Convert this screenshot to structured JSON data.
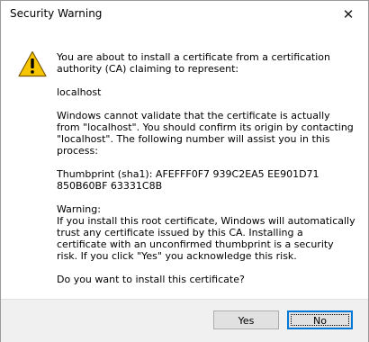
{
  "window": {
    "title": "Security Warning",
    "close_label": "✕"
  },
  "icon": "warning-triangle-icon",
  "message": {
    "intro": "You are about to install a certificate from a certification authority (CA) claiming to represent:",
    "host": "localhost",
    "validation": "Windows cannot validate that the certificate is actually from \"localhost\". You should confirm its origin by contacting \"localhost\". The following number will assist you in this process:",
    "thumbprint": "Thumbprint (sha1): AFEFFF0F7 939C2EA5 EE901D71 850B60BF 63331C8B",
    "warning_heading": "Warning:",
    "warning_body": "If you install this root certificate, Windows will automatically trust any certificate issued by this CA. Installing a certificate with an unconfirmed thumbprint is a security risk. If you click \"Yes\" you acknowledge this risk.",
    "question": "Do you want to install this certificate?"
  },
  "buttons": {
    "yes_label": "Yes",
    "no_label": "No"
  },
  "colors": {
    "warning_fill": "#f7c600",
    "focus_border": "#0078d7"
  }
}
